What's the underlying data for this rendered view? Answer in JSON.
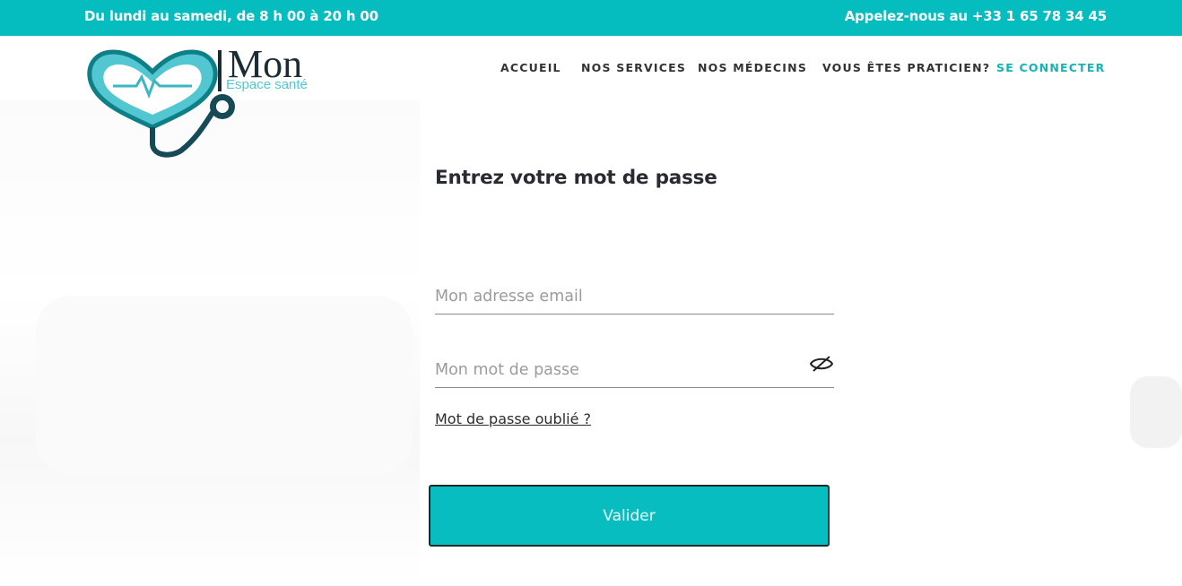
{
  "topbar": {
    "hours": "Du lundi au samedi, de 8 h 00 à 20 h 00",
    "phone": "Appelez-nous au +33 1 65 78 34 45"
  },
  "logo": {
    "wordmark": "Mon",
    "subtitle": "Espace santé"
  },
  "nav": {
    "items": [
      {
        "label": "ACCUEIL"
      },
      {
        "label": "NOS SERVICES"
      },
      {
        "label": "NOS MÉDECINS"
      },
      {
        "label": "VOUS ÊTES PRATICIEN?"
      },
      {
        "label": "SE CONNECTER",
        "active": true
      }
    ]
  },
  "login": {
    "title": "Entrez votre mot de passe",
    "email_placeholder": "Mon adresse email",
    "password_placeholder": "Mon mot de passe",
    "forgot_label": "Mot de passe oublié ?",
    "submit_label": "Valider"
  },
  "colors": {
    "accent": "#05bcbf",
    "nav_active": "#14b3b6",
    "text_dark": "#2a2a33"
  }
}
